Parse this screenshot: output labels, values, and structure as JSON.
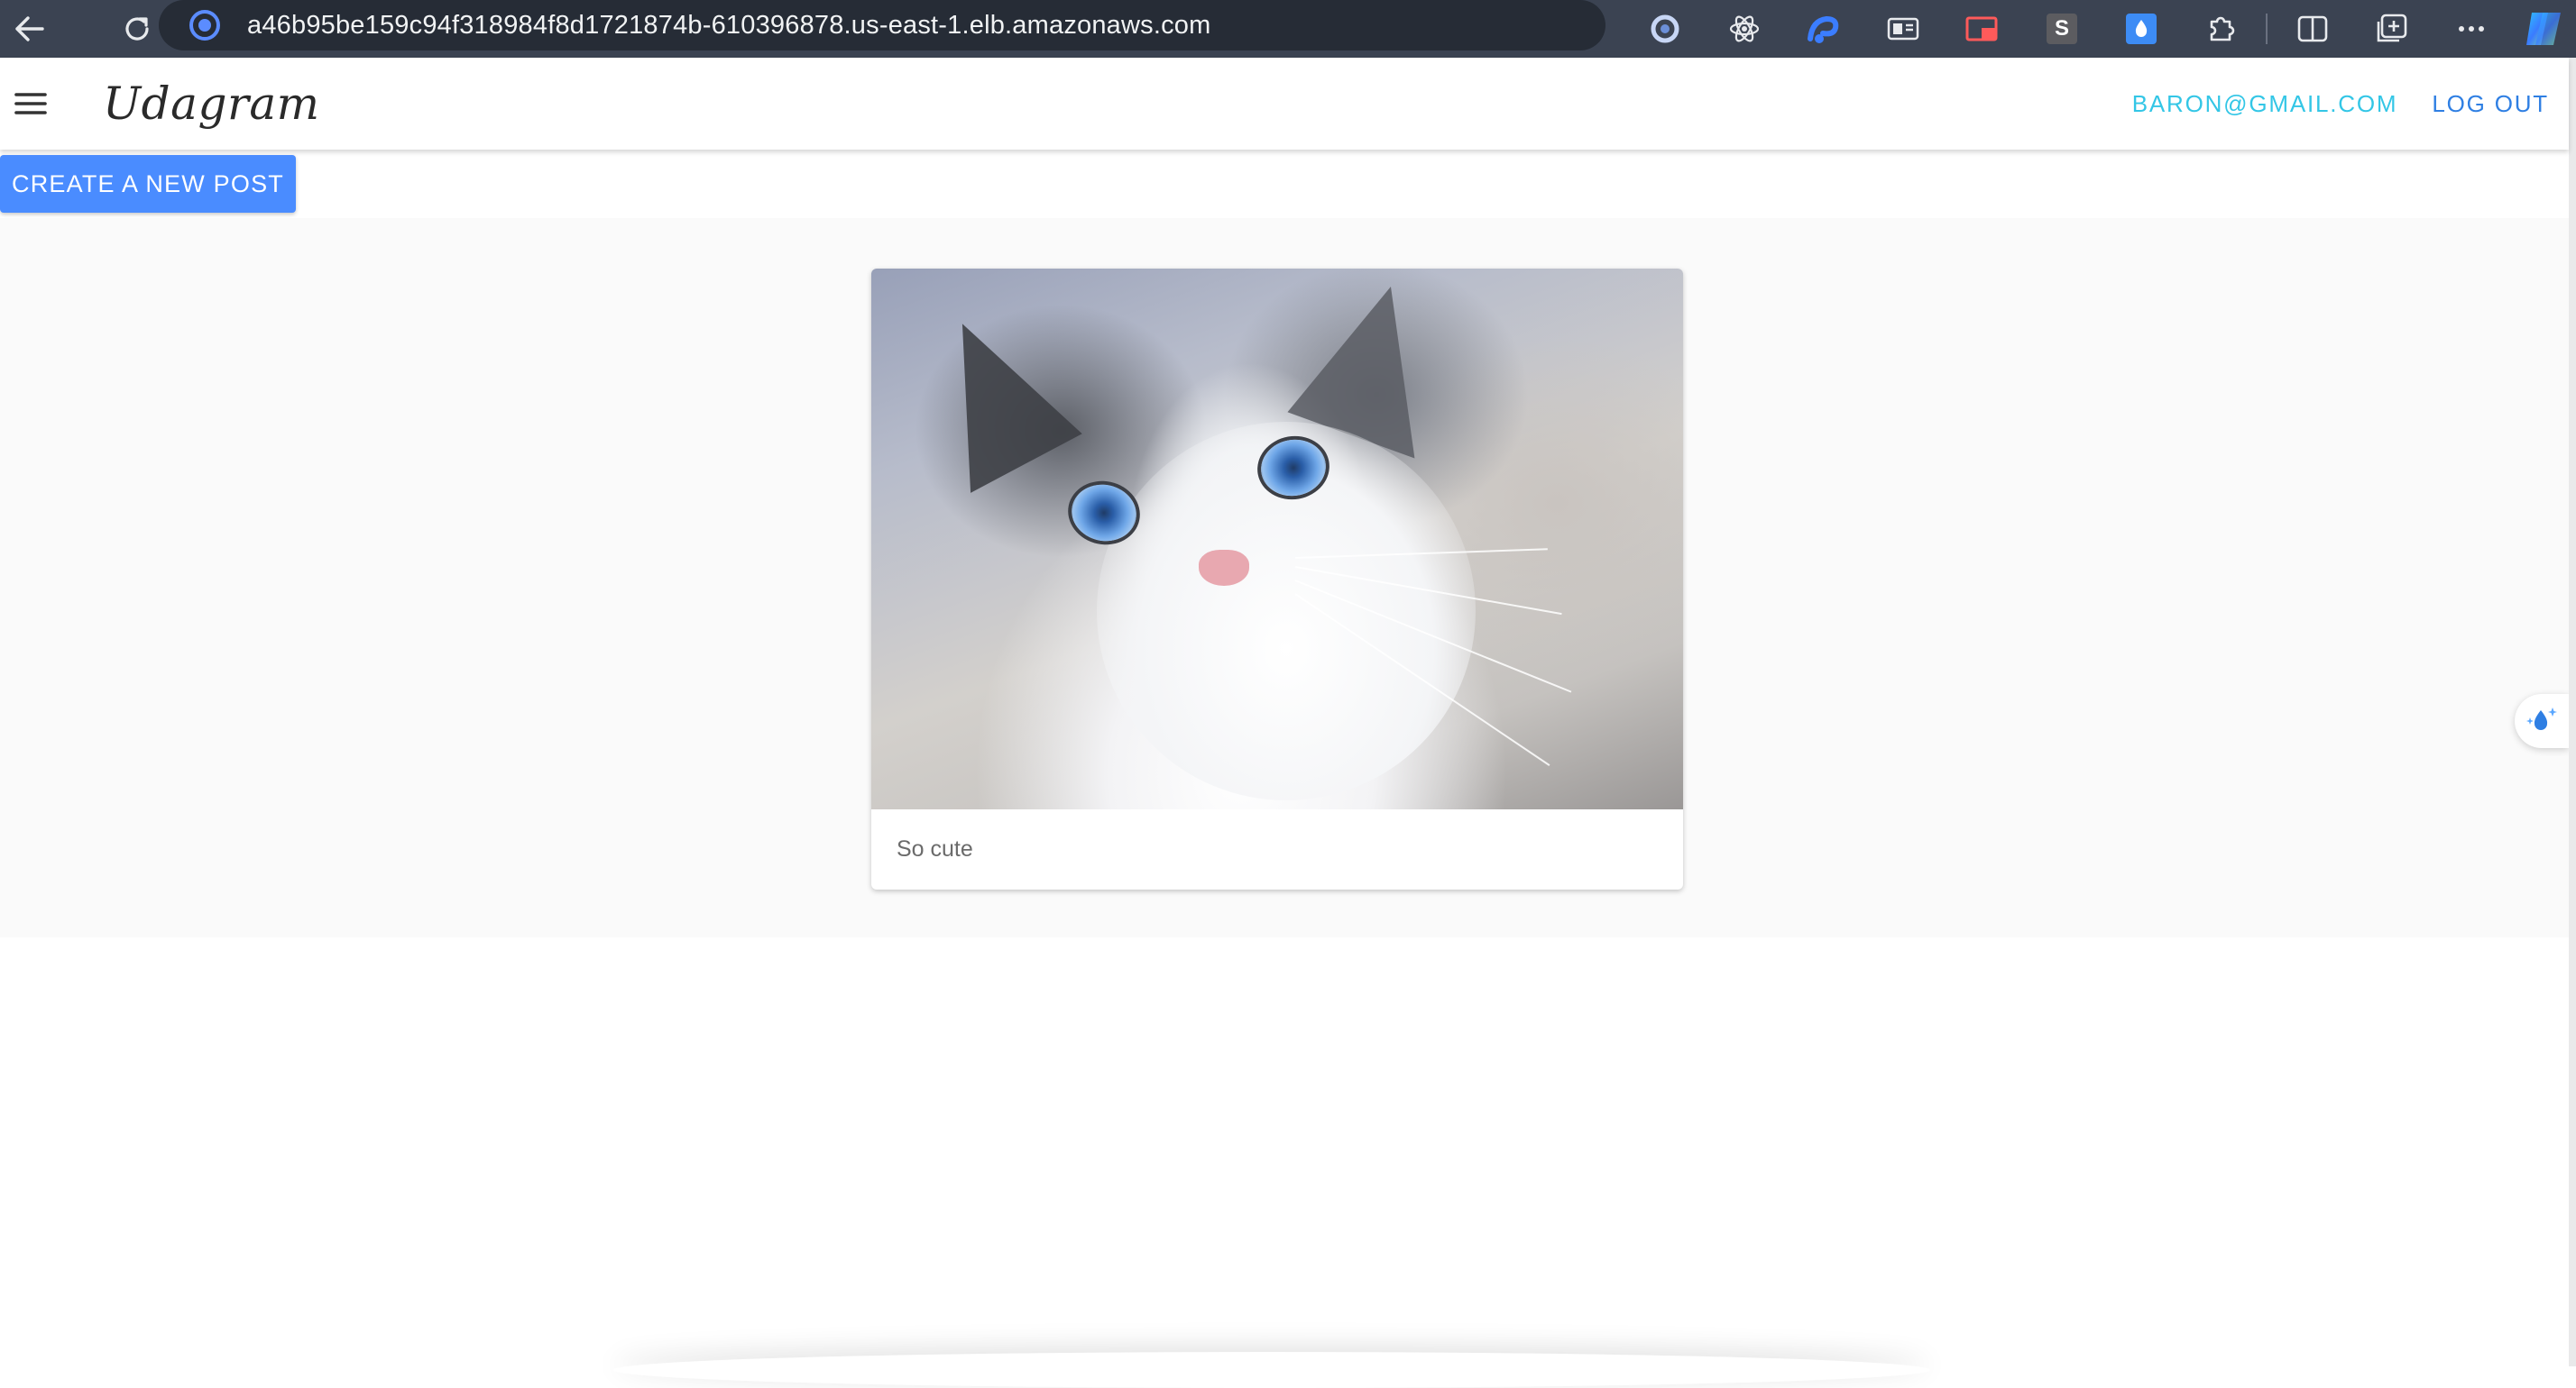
{
  "browser": {
    "url": "a46b95be159c94f318984f8d1721874b-610396878.us-east-1.elb.amazonaws.com",
    "icons": {
      "back": "arrow-left-icon",
      "reload": "reload-icon",
      "site": "site-info-icon",
      "extensions": [
        "circle-extension-icon",
        "react-devtools-icon",
        "redux-extension-icon",
        "reader-extension-icon",
        "picture-in-picture-icon",
        "s-extension-icon",
        "droplet-extension-icon",
        "puzzle-icon"
      ],
      "split": "split-screen-icon",
      "collections": "collections-icon",
      "more": "more-icon",
      "copilot": "copilot-icon"
    },
    "s_ext_label": "S"
  },
  "header": {
    "brand": "Udagram",
    "user_email": "BARON@GMAIL.COM",
    "logout_label": "LOG OUT",
    "colors": {
      "email": "#33c6e6",
      "logout": "#2f7fe3"
    }
  },
  "actions": {
    "create_post_label": "CREATE A NEW POST",
    "accent_color": "#4a8cff"
  },
  "feed": {
    "posts": [
      {
        "image_alt": "cat",
        "caption": "So cute"
      }
    ]
  }
}
